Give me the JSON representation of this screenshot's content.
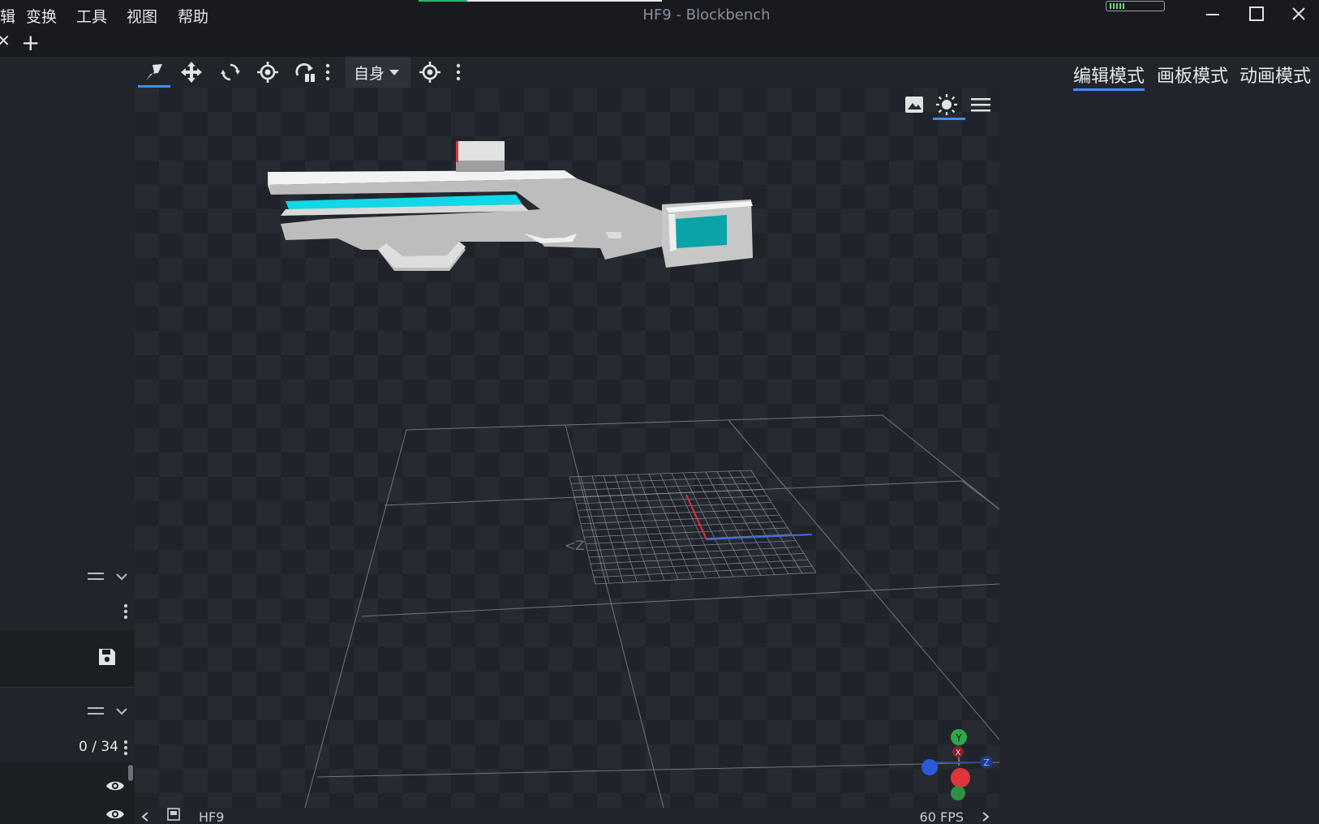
{
  "window": {
    "title": "HF9 - Blockbench",
    "menu": [
      "辑",
      "变换",
      "工具",
      "视图",
      "帮助"
    ]
  },
  "tabs": {
    "close_glyph": "✕",
    "add_glyph": "+"
  },
  "toolbar": {
    "tools": [
      "move-tool-icon",
      "translate-icon",
      "rotate-icon",
      "pivot-icon",
      "mirror-icon"
    ],
    "space_label": "自身"
  },
  "modes": {
    "edit": "编辑模式",
    "paint": "画板模式",
    "animate": "动画模式"
  },
  "outliner": {
    "count": "0 / 34"
  },
  "statusbar": {
    "model_name": "HF9",
    "fps": "60 FPS"
  },
  "viewport": {
    "compass_label": "<Z",
    "gizmo": {
      "y": "Y",
      "x": "X",
      "z": "Z"
    }
  },
  "colors": {
    "accent": "#3e90ff",
    "cyan": "#12d7e6",
    "teal_screen": "#0aa3a8"
  }
}
